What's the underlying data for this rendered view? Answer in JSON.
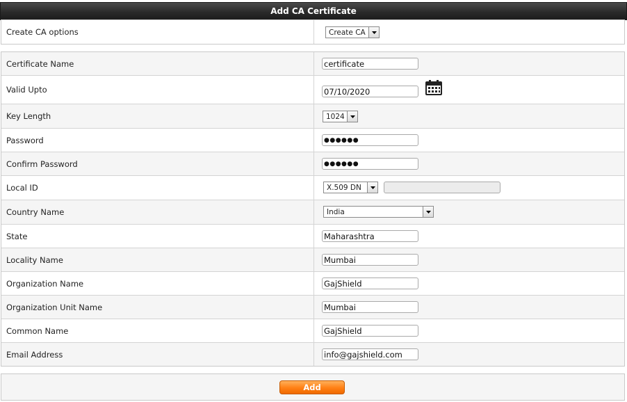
{
  "header": {
    "title": "Add CA Certificate"
  },
  "options": {
    "label": "Create CA options",
    "select_value": "Create CA"
  },
  "form": {
    "certificate_name": {
      "label": "Certificate Name",
      "value": "certificate"
    },
    "valid_upto": {
      "label": "Valid Upto",
      "value": "07/10/2020",
      "icon": "calendar-icon"
    },
    "key_length": {
      "label": "Key Length",
      "value": "1024"
    },
    "password": {
      "label": "Password",
      "value": "●●●●●●"
    },
    "confirm_password": {
      "label": "Confirm Password",
      "value": "●●●●●●"
    },
    "local_id": {
      "label": "Local ID",
      "select_value": "X.509 DN",
      "text_value": ""
    },
    "country_name": {
      "label": "Country Name",
      "value": "India"
    },
    "state": {
      "label": "State",
      "value": "Maharashtra"
    },
    "locality_name": {
      "label": "Locality Name",
      "value": "Mumbai"
    },
    "organization_name": {
      "label": "Organization Name",
      "value": "GajShield"
    },
    "organization_unit_name": {
      "label": "Organization Unit Name",
      "value": "Mumbai"
    },
    "common_name": {
      "label": "Common Name",
      "value": "GajShield"
    },
    "email_address": {
      "label": "Email Address",
      "value": "info@gajshield.com"
    }
  },
  "footer": {
    "add_label": "Add"
  },
  "colors": {
    "header_bg": "#2b2b2b",
    "button_orange": "#ff7f14",
    "row_alt": "#f5f5f5"
  }
}
